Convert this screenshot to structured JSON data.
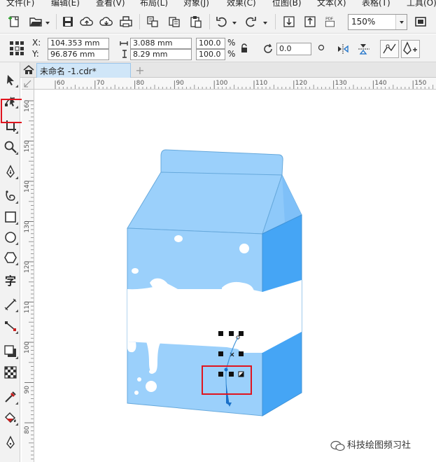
{
  "menu": [
    "文件(F)",
    "编辑(E)",
    "查看(V)",
    "布局(L)",
    "对象(J)",
    "效果(C)",
    "位图(B)",
    "文本(X)",
    "表格(T)",
    "工具(O)"
  ],
  "toolbar": {
    "zoom_value": "150%",
    "icons": [
      "new-document-icon",
      "open-folder-icon",
      "save-icon",
      "upload-cloud-icon",
      "download-cloud-icon",
      "print-icon",
      "cut-icon",
      "copy-icon",
      "paste-icon",
      "undo-icon",
      "redo-icon",
      "import-icon",
      "export-icon",
      "pdf-icon",
      "fullscreen-icon"
    ],
    "pdf_label": "PDF"
  },
  "properties": {
    "x_label": "X:",
    "x_value": "104.353 mm",
    "y_label": "Y:",
    "y_value": "96.876 mm",
    "width_value": "3.088 mm",
    "height_value": "8.29 mm",
    "scale_w": "100.0",
    "scale_h": "100.0",
    "percent": "%",
    "rotation": "0.0"
  },
  "document_tab": {
    "title": "未命名 -1.cdr*"
  },
  "tools": [
    "pick-tool",
    "shape-tool",
    "crop-tool",
    "zoom-tool",
    "pen-tool",
    "bspline-tool",
    "rectangle-tool",
    "ellipse-tool",
    "polygon-tool",
    "text-tool",
    "parallel-dimension-tool",
    "connector-tool",
    "drop-shadow-tool",
    "transparency-tool",
    "eyedropper-tool",
    "interactive-fill-tool",
    "smart-fill-tool"
  ],
  "text_tool_glyph": "字",
  "hruler_labels": [
    "60",
    "70",
    "80",
    "90",
    "100",
    "110",
    "120",
    "130",
    "140",
    "150"
  ],
  "vruler_labels": [
    "160",
    "150",
    "140",
    "130",
    "120",
    "110",
    "100",
    "90",
    "80"
  ],
  "watermark": "科技绘图频习社",
  "colors": {
    "carton_light": "#9bd0fb",
    "carton_mid": "#8ec9fa",
    "carton_dark": "#45a5f5",
    "band": "#ffffff",
    "highlight": "#e0141e"
  }
}
